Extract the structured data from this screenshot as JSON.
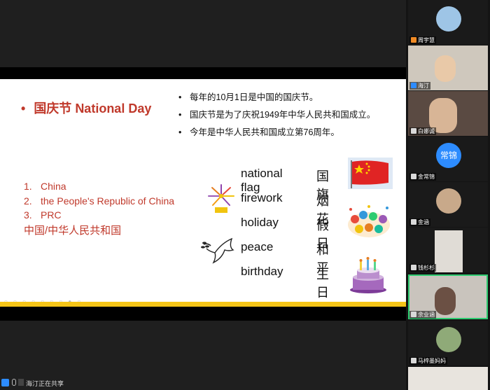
{
  "slide": {
    "title": "国庆节 National Day",
    "bullet": "•",
    "facts": [
      "每年的10月1日是中国的国庆节。",
      "国庆节是为了庆祝1949年中华人民共和国成立。",
      "今年是中华人民共和国成立第76周年。"
    ],
    "names": [
      {
        "num": "1.",
        "text": "China"
      },
      {
        "num": "2.",
        "text": "the People's Republic of China"
      },
      {
        "num": "3.",
        "text": "PRC"
      }
    ],
    "names_cn": "中国/中华人民共和国",
    "vocab": [
      {
        "en": "national flag",
        "zh": "国旗"
      },
      {
        "en": "firework",
        "zh": "烟花"
      },
      {
        "en": "holiday",
        "zh": "假日"
      },
      {
        "en": "peace",
        "zh": "和平"
      },
      {
        "en": "birthday",
        "zh": "生日"
      }
    ]
  },
  "status": {
    "sharing_text": "海汀正在共享"
  },
  "participants": [
    {
      "name": "周宇慧",
      "badge": "orange"
    },
    {
      "name": "海汀",
      "badge": "blue"
    },
    {
      "name": "白娜诚",
      "badge": "gray"
    },
    {
      "name": "金常锦",
      "badge": "gray",
      "avatar_text": "常锦"
    },
    {
      "name": "金涵",
      "badge": "gray"
    },
    {
      "name": "钱杉杉",
      "badge": "gray"
    },
    {
      "name": "余业涵",
      "badge": "gray"
    },
    {
      "name": "马梓墨妈妈",
      "badge": "gray"
    }
  ],
  "colors": {
    "title_red": "#c0392b",
    "slide_bar": "#f5c518",
    "active_speaker": "#2ecc71",
    "avatar_blue": "#2d8cff"
  }
}
